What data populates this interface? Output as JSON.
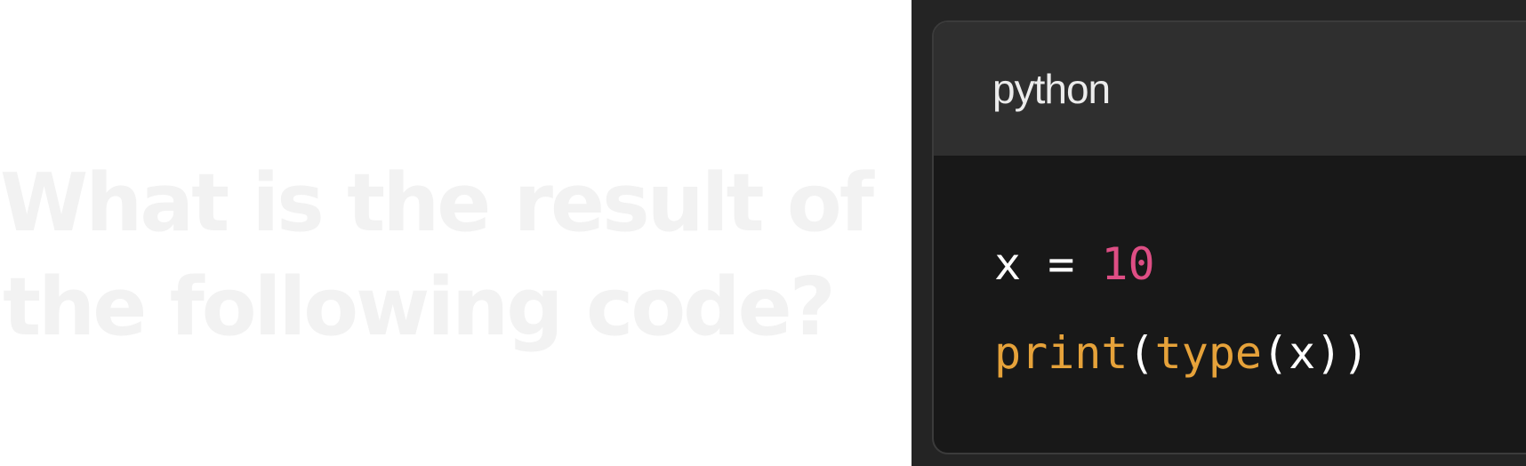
{
  "question": {
    "line1": "What is the result of",
    "line2": "the following code?"
  },
  "code_block": {
    "language": "python",
    "lines": [
      {
        "tokens": {
          "var": "x",
          "op": " = ",
          "num": "10"
        }
      },
      {
        "tokens": {
          "fn1": "print",
          "p1": "(",
          "fn2": "type",
          "p2": "(",
          "arg": "x",
          "p3": "))"
        }
      }
    ]
  },
  "colors": {
    "question_text": "#f2f2f2",
    "panel_bg": "#242424",
    "header_bg": "#2f2f2f",
    "code_bg": "#181818",
    "number": "#de4e84",
    "function": "#e6a23a",
    "text": "#ffffff"
  }
}
